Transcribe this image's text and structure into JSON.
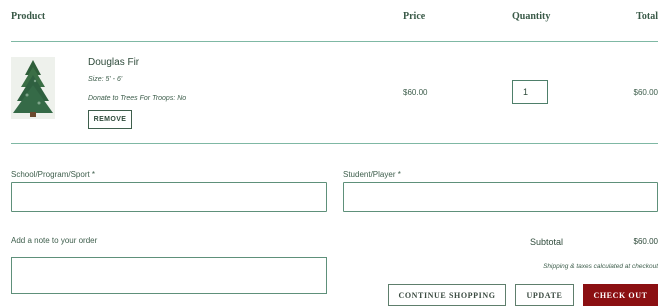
{
  "table_header": {
    "product": "Product",
    "price": "Price",
    "quantity": "Quantity",
    "total": "Total"
  },
  "item": {
    "image_icon": "christmas-tree-photo",
    "name": "Douglas Fir",
    "size": "Size: 5' - 6'",
    "donate": "Donate to Trees For Troops: No",
    "remove_label": "REMOVE",
    "price": "$60.00",
    "quantity": "1",
    "total": "$60.00"
  },
  "form": {
    "school_label": "School/Program/Sport *",
    "student_label": "Student/Player *",
    "note_label": "Add a note to your order"
  },
  "summary": {
    "subtotal_label": "Subtotal",
    "subtotal_value": "$60.00",
    "shipping_note": "Shipping & taxes calculated at checkout"
  },
  "buttons": {
    "continue_label": "CONTINUE SHOPPING",
    "update_label": "UPDATE",
    "checkout_label": "CHECK OUT"
  },
  "colors": {
    "accent_rule": "#7fb8a4",
    "checkout_bg": "#8b0f12",
    "text": "#2e4a3a"
  }
}
